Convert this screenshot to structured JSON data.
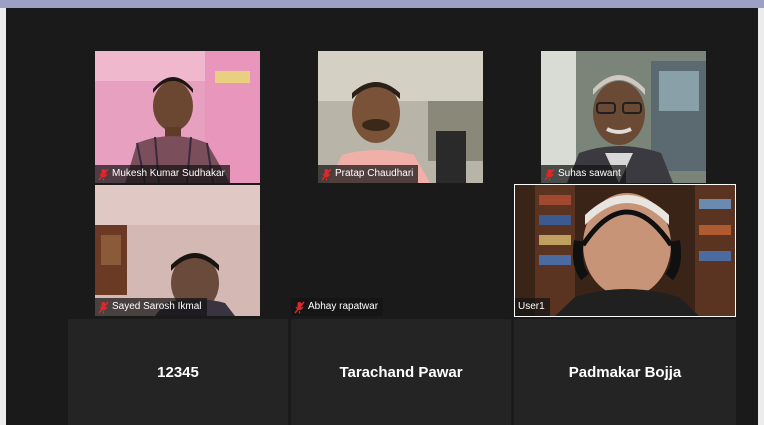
{
  "participants": [
    {
      "name": "Mukesh Kumar Sudhakar",
      "muted": true,
      "video": true
    },
    {
      "name": "Pratap Chaudhari",
      "muted": true,
      "video": true
    },
    {
      "name": "Suhas sawant",
      "muted": true,
      "video": true
    },
    {
      "name": "Sayed Sarosh Ikmal",
      "muted": true,
      "video": true
    },
    {
      "name": "Abhay rapatwar",
      "muted": true,
      "video": false
    },
    {
      "name": "User1",
      "muted": false,
      "video": true,
      "active_speaker": true
    }
  ],
  "name_only": [
    {
      "name": "12345"
    },
    {
      "name": "Tarachand Pawar"
    },
    {
      "name": "Padmakar Bojja"
    }
  ],
  "icons": {
    "muted": "mic-muted-icon"
  },
  "colors": {
    "top_bar": "#9d9fc4",
    "background": "#1a1a1a",
    "mute_icon": "#e02828",
    "active_border": "#ffffff"
  }
}
